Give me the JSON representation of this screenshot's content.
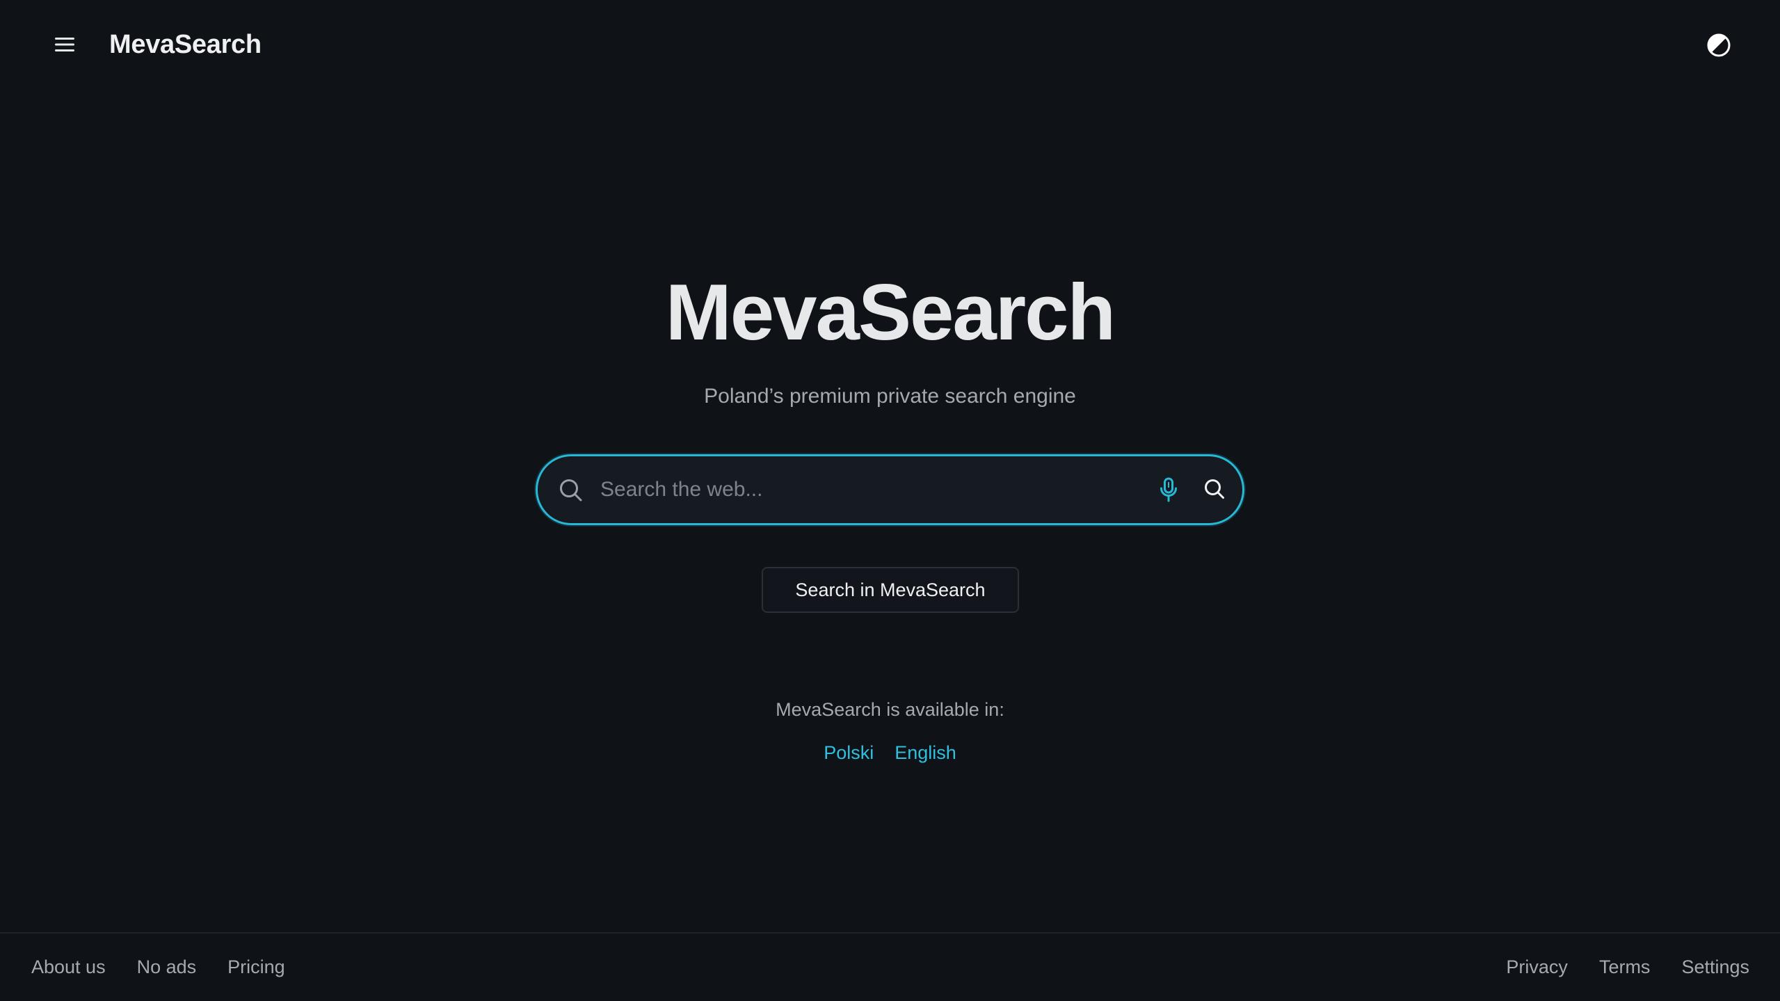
{
  "header": {
    "brand": "MevaSearch",
    "menu_icon": "hamburger-menu-icon",
    "theme_icon": "contrast-toggle-icon"
  },
  "hero": {
    "title": "MevaSearch",
    "tagline": "Poland’s premium private search engine"
  },
  "search": {
    "placeholder": "Search the web...",
    "value": "",
    "lead_icon": "search-icon",
    "voice_icon": "microphone-icon",
    "submit_icon": "search-icon",
    "button_label": "Search in MevaSearch"
  },
  "languages": {
    "label": "MevaSearch is available in:",
    "items": [
      "Polski",
      "English"
    ]
  },
  "footer": {
    "left_links": [
      "About us",
      "No ads",
      "Pricing"
    ],
    "right_links": [
      "Privacy",
      "Terms",
      "Settings"
    ]
  },
  "colors": {
    "background": "#0f1217",
    "accent": "#27b8d6",
    "text": "#e7e8ea",
    "muted": "#a4aab2"
  }
}
